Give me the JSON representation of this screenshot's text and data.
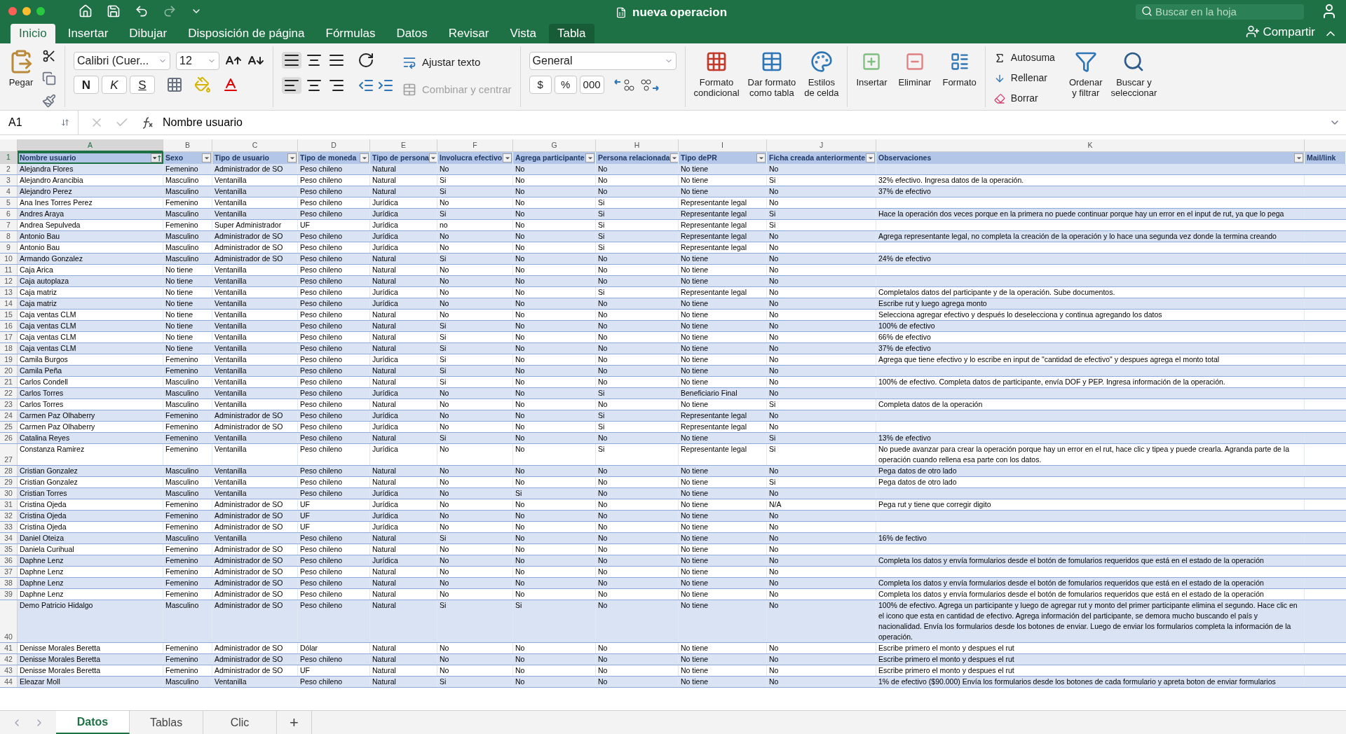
{
  "window": {
    "title": "nueva operacion",
    "search": {
      "placeholder": "Buscar en la hoja"
    }
  },
  "menu_tabs": [
    {
      "label": "Inicio",
      "selected": true,
      "kind": "normal"
    },
    {
      "label": "Insertar",
      "selected": false,
      "kind": "normal"
    },
    {
      "label": "Dibujar",
      "selected": false,
      "kind": "normal"
    },
    {
      "label": "Disposición de página",
      "selected": false,
      "kind": "normal"
    },
    {
      "label": "Fórmulas",
      "selected": false,
      "kind": "normal"
    },
    {
      "label": "Datos",
      "selected": false,
      "kind": "normal"
    },
    {
      "label": "Revisar",
      "selected": false,
      "kind": "normal"
    },
    {
      "label": "Vista",
      "selected": false,
      "kind": "normal"
    },
    {
      "label": "Tabla",
      "selected": false,
      "kind": "contextual"
    }
  ],
  "share": "Compartir",
  "ribbon": {
    "paste": "Pegar",
    "font": "Calibri (Cuer...",
    "size": "12",
    "font_styles": [
      "N",
      "K",
      "S"
    ],
    "wrap": "Ajustar texto",
    "merge": {
      "label": "Combinar y centrar",
      "disabled": true
    },
    "number_format": "General",
    "number_buttons": [
      "$",
      "%",
      "000"
    ],
    "styles": [
      "Formato\ncondicional",
      "Dar formato\ncomo tabla",
      "Estilos\nde celda"
    ],
    "cells": [
      "Insertar",
      "Eliminar",
      "Formato"
    ],
    "editing": [
      "Autosuma",
      "Rellenar",
      "Borrar"
    ],
    "big_editing": [
      "Ordenar\ny filtrar",
      "Buscar y\nseleccionar"
    ]
  },
  "formula_bar": {
    "name_box": "A1",
    "value": "Nombre usuario"
  },
  "columns": [
    {
      "letter": "A",
      "name": "Nombre usuario",
      "selected": true,
      "sorted": true,
      "filter": true
    },
    {
      "letter": "B",
      "name": "Sexo",
      "selected": false,
      "sorted": false,
      "filter": true
    },
    {
      "letter": "C",
      "name": "Tipo de usuario",
      "selected": false,
      "sorted": false,
      "filter": true
    },
    {
      "letter": "D",
      "name": "Tipo de moneda",
      "selected": false,
      "sorted": false,
      "filter": true
    },
    {
      "letter": "E",
      "name": "Tipo de persona",
      "selected": false,
      "sorted": false,
      "filter": true
    },
    {
      "letter": "F",
      "name": "Involucra efectivo",
      "selected": false,
      "sorted": false,
      "filter": true
    },
    {
      "letter": "G",
      "name": "Agrega participante",
      "selected": false,
      "sorted": false,
      "filter": true
    },
    {
      "letter": "H",
      "name": "Persona relacionada",
      "selected": false,
      "sorted": false,
      "filter": true
    },
    {
      "letter": "I",
      "name": "Tipo dePR",
      "selected": false,
      "sorted": false,
      "filter": true
    },
    {
      "letter": "J",
      "name": "Ficha creada anteriormente",
      "selected": false,
      "sorted": false,
      "filter": true
    },
    {
      "letter": "K",
      "name": "Observaciones",
      "selected": false,
      "sorted": false,
      "filter": true
    },
    {
      "name": "Mail/link",
      "selected": false,
      "sorted": false,
      "filter": false
    }
  ],
  "header_row": {
    "number": "1",
    "selected": true
  },
  "rows": [
    {
      "n": "2",
      "cells": [
        "Alejandra Flores",
        "Femenino",
        "Administrador de SO",
        "Peso chileno",
        "Natural",
        "No",
        "No",
        "No",
        "No tiene",
        "No"
      ]
    },
    {
      "n": "3",
      "cells": [
        "Alejandro Arancibia",
        "Masculino",
        "Ventanilla",
        "Peso chileno",
        "Natural",
        "Si",
        "No",
        "No",
        "No tiene",
        "Si"
      ],
      "obs": "32% efectivo. Ingresa datos de la operación."
    },
    {
      "n": "4",
      "cells": [
        "Alejandro Perez",
        "Masculino",
        "Ventanilla",
        "Peso chileno",
        "Natural",
        "Si",
        "No",
        "No",
        "No tiene",
        "No"
      ],
      "obs": "37% de efectivo"
    },
    {
      "n": "5",
      "cells": [
        "Ana Ines Torres Perez",
        "Femenino",
        "Ventanilla",
        "Peso chileno",
        "Jurídica",
        "No",
        "No",
        "Si",
        "Representante legal",
        "No"
      ]
    },
    {
      "n": "6",
      "cells": [
        "Andres Araya",
        "Masculino",
        "Ventanilla",
        "Peso chileno",
        "Jurídica",
        "Si",
        "No",
        "Si",
        "Representante legal",
        "Si"
      ],
      "obs": "Hace la operación dos veces porque en la primera no puede continuar porque hay un error en el input de rut, ya que lo pega"
    },
    {
      "n": "7",
      "cells": [
        "Andrea Sepulveda",
        "Femenino",
        "Super Administrador",
        "UF",
        "Jurídica",
        "no",
        "No",
        "Si",
        "Representante legal",
        "Si"
      ]
    },
    {
      "n": "8",
      "cells": [
        "Antonio Bau",
        "Masculino",
        "Administrador de SO",
        "Peso chileno",
        "Jurídica",
        "No",
        "No",
        "Si",
        "Representante legal",
        "No"
      ],
      "obs": "Agrega representante legal, no completa la creación de la operación y lo hace una segunda vez donde la termina creando"
    },
    {
      "n": "9",
      "cells": [
        "Antonio Bau",
        "Masculino",
        "Administrador de SO",
        "Peso chileno",
        "Jurídica",
        "No",
        "No",
        "Si",
        "Representante legal",
        "No"
      ]
    },
    {
      "n": "10",
      "cells": [
        "Armando Gonzalez",
        "Masculino",
        "Administrador de SO",
        "Peso chileno",
        "Natural",
        "Si",
        "No",
        "No",
        "No tiene",
        "No"
      ],
      "obs": "24% de efectivo"
    },
    {
      "n": "11",
      "cells": [
        "Caja Arica",
        "No tiene",
        "Ventanilla",
        "Peso chileno",
        "Natural",
        "No",
        "No",
        "No",
        "No tiene",
        "No"
      ]
    },
    {
      "n": "12",
      "cells": [
        "Caja autoplaza",
        "No tiene",
        "Ventanilla",
        "Peso chileno",
        "Natural",
        "No",
        "No",
        "No",
        "No tiene",
        "No"
      ]
    },
    {
      "n": "13",
      "cells": [
        "Caja matriz",
        "No tiene",
        "Ventanilla",
        "Peso chileno",
        "Jurídica",
        "No",
        "No",
        "Si",
        "Representante legal",
        "No"
      ],
      "obs": "Completalos datos del participante y de la operación. Sube documentos."
    },
    {
      "n": "14",
      "cells": [
        "Caja matriz",
        "No tiene",
        "Ventanilla",
        "Peso chileno",
        "Jurídica",
        "No",
        "No",
        "No",
        "No tiene",
        "No"
      ],
      "obs": "Escribe rut y luego agrega monto"
    },
    {
      "n": "15",
      "cells": [
        "Caja ventas CLM",
        "No tiene",
        "Ventanilla",
        "Peso chileno",
        "Natural",
        "No",
        "No",
        "No",
        "No tiene",
        "No"
      ],
      "obs": "Selecciona agregar efectivo y después lo deselecciona y continua agregando los datos"
    },
    {
      "n": "16",
      "cells": [
        "Caja ventas CLM",
        "No tiene",
        "Ventanilla",
        "Peso chileno",
        "Natural",
        "Si",
        "No",
        "No",
        "No tiene",
        "No"
      ],
      "obs": "100% de efectivo"
    },
    {
      "n": "17",
      "cells": [
        "Caja ventas CLM",
        "No tiene",
        "Ventanilla",
        "Peso chileno",
        "Natural",
        "Si",
        "No",
        "No",
        "No tiene",
        "No"
      ],
      "obs": "66% de efectivo"
    },
    {
      "n": "18",
      "cells": [
        "Caja ventas CLM",
        "No tiene",
        "Ventanilla",
        "Peso chileno",
        "Natural",
        "Si",
        "No",
        "No",
        "No tiene",
        "No"
      ],
      "obs": "37% de efectivo"
    },
    {
      "n": "19",
      "cells": [
        "Camila Burgos",
        "Femenino",
        "Ventanilla",
        "Peso chileno",
        "Jurídica",
        "Si",
        "No",
        "No",
        "No tiene",
        "No"
      ],
      "obs": "Agrega que tiene efectivo y lo escribe en input de \"cantidad de efectivo\" y despues agrega el monto total"
    },
    {
      "n": "20",
      "cells": [
        "Camila Peña",
        "Femenino",
        "Ventanilla",
        "Peso chileno",
        "Natural",
        "Si",
        "No",
        "No",
        "No tiene",
        "No"
      ]
    },
    {
      "n": "21",
      "cells": [
        "Carlos Condell",
        "Masculino",
        "Ventanilla",
        "Peso chileno",
        "Natural",
        "Si",
        "No",
        "No",
        "No tiene",
        "No"
      ],
      "obs": "100% de efectivo. Completa datos de participante, envía DOF y PEP. Ingresa información de la operación."
    },
    {
      "n": "22",
      "cells": [
        "Carlos Torres",
        "Masculino",
        "Ventanilla",
        "Peso chileno",
        "Jurídica",
        "No",
        "No",
        "Si",
        "Beneficiario Final",
        "No"
      ]
    },
    {
      "n": "23",
      "cells": [
        "Carlos Torres",
        "Masculino",
        "Ventanilla",
        "Peso chileno",
        "Natural",
        "No",
        "No",
        "No",
        "No tiene",
        "Si"
      ],
      "obs": "Completa datos de la operación"
    },
    {
      "n": "24",
      "cells": [
        "Carmen Paz Olhaberry",
        "Femenino",
        "Administrador de SO",
        "Peso chileno",
        "Jurídica",
        "No",
        "No",
        "Si",
        "Representante legal",
        "No"
      ]
    },
    {
      "n": "25",
      "cells": [
        "Carmen Paz Olhaberry",
        "Femenino",
        "Administrador de SO",
        "Peso chileno",
        "Jurídica",
        "No",
        "No",
        "Si",
        "Representante legal",
        "No"
      ]
    },
    {
      "n": "26",
      "cells": [
        "Catalina Reyes",
        "Femenino",
        "Ventanilla",
        "Peso chileno",
        "Natural",
        "Si",
        "No",
        "No",
        "No tiene",
        "Si"
      ],
      "obs": "13% de efectivo"
    },
    {
      "n": "27",
      "cells": [
        "Constanza Ramirez",
        "Femenino",
        "Ventanilla",
        "Peso chileno",
        "Jurídica",
        "No",
        "No",
        "Si",
        "Representante legal",
        "Si"
      ],
      "obs": "No puede avanzar para crear la operación porque hay un error en el rut, hace clic y tipea y puede crearla. Agranda parte de la operación cuando rellena esa parte con los datos."
    },
    {
      "n": "28",
      "cells": [
        "Cristian Gonzalez",
        "Masculino",
        "Ventanilla",
        "Peso chileno",
        "Natural",
        "No",
        "No",
        "No",
        "No tiene",
        "No"
      ],
      "obs": "Pega datos de otro lado"
    },
    {
      "n": "29",
      "cells": [
        "Cristian Gonzalez",
        "Masculino",
        "Ventanilla",
        "Peso chileno",
        "Natural",
        "No",
        "No",
        "No",
        "No tiene",
        "Si"
      ],
      "obs": "Pega datos de otro lado"
    },
    {
      "n": "30",
      "cells": [
        "Cristian Torres",
        "Masculino",
        "Ventanilla",
        "Peso chileno",
        "Jurídica",
        "No",
        "Si",
        "No",
        "No tiene",
        "No"
      ]
    },
    {
      "n": "31",
      "cells": [
        "Cristina Ojeda",
        "Femenino",
        "Administrador de SO",
        "UF",
        "Jurídica",
        "No",
        "No",
        "No",
        "No tiene",
        "N/A"
      ],
      "obs": "Pega rut y tiene que corregir digito"
    },
    {
      "n": "32",
      "cells": [
        "Cristina Ojeda",
        "Femenino",
        "Administrador de SO",
        "UF",
        "Jurídica",
        "No",
        "No",
        "No",
        "No tiene",
        "No"
      ]
    },
    {
      "n": "33",
      "cells": [
        "Cristina Ojeda",
        "Femenino",
        "Administrador de SO",
        "UF",
        "Jurídica",
        "No",
        "No",
        "No",
        "No tiene",
        "No"
      ]
    },
    {
      "n": "34",
      "cells": [
        "Daniel Oteiza",
        "Masculino",
        "Ventanilla",
        "Peso chileno",
        "Natural",
        "Si",
        "No",
        "No",
        "No tiene",
        "No"
      ],
      "obs": "16% de fectivo"
    },
    {
      "n": "35",
      "cells": [
        "Daniela Curihual",
        "Femenino",
        "Administrador de SO",
        "Peso chileno",
        "Natural",
        "No",
        "No",
        "No",
        "No tiene",
        "No"
      ]
    },
    {
      "n": "36",
      "cells": [
        "Daphne Lenz",
        "Femenino",
        "Administrador de SO",
        "Peso chileno",
        "Jurídica",
        "No",
        "No",
        "No",
        "No tiene",
        "No"
      ],
      "obs": "Completa los datos y envía formularios desde el botón de fomularios requeridos que está en el estado de la operación"
    },
    {
      "n": "37",
      "cells": [
        "Daphne Lenz",
        "Femenino",
        "Administrador de SO",
        "Peso chileno",
        "Natural",
        "No",
        "No",
        "No",
        "No tiene",
        "No"
      ]
    },
    {
      "n": "38",
      "cells": [
        "Daphne Lenz",
        "Femenino",
        "Administrador de SO",
        "Peso chileno",
        "Natural",
        "No",
        "No",
        "No",
        "No tiene",
        "No"
      ],
      "obs": "Completa los datos y envía formularios desde el botón de fomularios requeridos que está en el estado de la operación"
    },
    {
      "n": "39",
      "cells": [
        "Daphne Lenz",
        "Femenino",
        "Administrador de SO",
        "Peso chileno",
        "Natural",
        "No",
        "No",
        "No",
        "No tiene",
        "No"
      ],
      "obs": "Completa los datos y envía formularios desde el botón de fomularios requeridos que está en el estado de la operación"
    },
    {
      "n": "40",
      "cells": [
        "Demo Patricio Hidalgo",
        "Masculino",
        "Administrador de SO",
        "Peso chileno",
        "Natural",
        "Si",
        "Si",
        "No",
        "No tiene",
        "No"
      ],
      "obs": "100% de efectivo. Agrega un participante y luego de agregar rut y monto del primer participante elimina el segundo. Hace clic en el icono que esta en cantidad de efectivo. Agrega información del participante, se demora mucho buscando el país y nacionalidad. Envía los formularios desde los botones de enviar. Luego de enviar los formularios completa la información de la operación."
    },
    {
      "n": "41",
      "cells": [
        "Denisse Morales Beretta",
        "Femenino",
        "Administrador de SO",
        "Dólar",
        "Natural",
        "No",
        "No",
        "No",
        "No tiene",
        "No"
      ],
      "obs": "Escribe primero el monto y despues el rut"
    },
    {
      "n": "42",
      "cells": [
        "Denisse Morales Beretta",
        "Femenino",
        "Administrador de SO",
        "Peso chileno",
        "Natural",
        "No",
        "No",
        "No",
        "No tiene",
        "No"
      ],
      "obs": "Escribe primero el monto y despues el rut"
    },
    {
      "n": "43",
      "cells": [
        "Denisse Morales Beretta",
        "Femenino",
        "Administrador de SO",
        "UF",
        "Natural",
        "No",
        "No",
        "No",
        "No tiene",
        "No"
      ],
      "obs": "Escribe primero el monto y despues el rut"
    },
    {
      "n": "44",
      "cells": [
        "Eleazar Moll",
        "Masculino",
        "Ventanilla",
        "Peso chileno",
        "Natural",
        "Si",
        "No",
        "No",
        "No tiene",
        "No"
      ],
      "obs": "1% de efectivo ($90.000) Envía los formularios desde los botones de cada formulario y apreta boton de enviar formularios"
    }
  ],
  "sheet_tabs": [
    {
      "label": "Datos",
      "selected": true
    },
    {
      "label": "Tablas",
      "selected": false
    },
    {
      "label": "Clic",
      "selected": false
    }
  ],
  "add_sheet": "+"
}
